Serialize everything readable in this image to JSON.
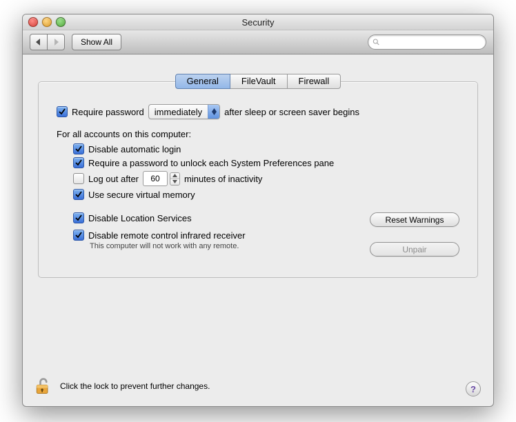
{
  "window": {
    "title": "Security"
  },
  "toolbar": {
    "show_all": "Show All",
    "search_placeholder": ""
  },
  "tabs": {
    "general": "General",
    "filevault": "FileVault",
    "firewall": "Firewall"
  },
  "general": {
    "require_password_label_pre": "Require password",
    "require_password_delay": "immediately",
    "require_password_label_post": "after sleep or screen saver begins",
    "all_accounts_header": "For all accounts on this computer:",
    "disable_auto_login": "Disable automatic login",
    "require_pw_sysprefs": "Require a password to unlock each System Preferences pane",
    "log_out_after_pre": "Log out after",
    "log_out_minutes": "60",
    "log_out_after_post": "minutes of inactivity",
    "secure_vm": "Use secure virtual memory",
    "disable_location": "Disable Location Services",
    "reset_warnings": "Reset Warnings",
    "disable_ir": "Disable remote control infrared receiver",
    "ir_subtext": "This computer will not work with any remote.",
    "unpair": "Unpair"
  },
  "lock": {
    "text": "Click the lock to prevent further changes."
  },
  "help": "?"
}
